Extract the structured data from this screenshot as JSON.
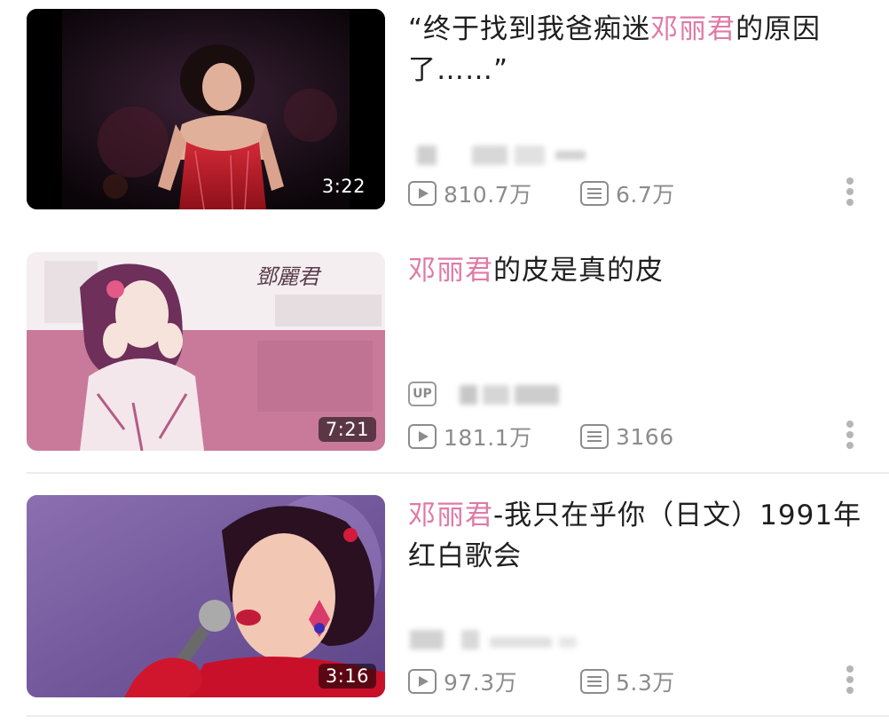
{
  "videos": [
    {
      "title_pre": "“终于找到我爸痴迷",
      "title_hl": "邓丽君",
      "title_post": "的原因了……”",
      "duration": "3:22",
      "views": "810.7万",
      "danmaku": "6.7万",
      "has_up_badge": false
    },
    {
      "title_pre": "",
      "title_hl": "邓丽君",
      "title_post": "的皮是真的皮",
      "duration": "7:21",
      "views": "181.1万",
      "danmaku": "3166",
      "has_up_badge": true,
      "thumb_text": "鄧麗君"
    },
    {
      "title_pre": "",
      "title_hl": "邓丽君",
      "title_post": "-我只在乎你（日文）1991年红白歌会",
      "duration": "3:16",
      "views": "97.3万",
      "danmaku": "5.3万",
      "has_up_badge": false
    }
  ],
  "up_badge_label": "UP",
  "icons": {
    "views": "play-count-icon",
    "danmaku": "danmaku-icon",
    "more": "more-vertical-icon"
  },
  "colors": {
    "highlight": "#e07aa6",
    "meta_gray": "#8c8c8c",
    "thumb2_band": "#c97a9a"
  }
}
